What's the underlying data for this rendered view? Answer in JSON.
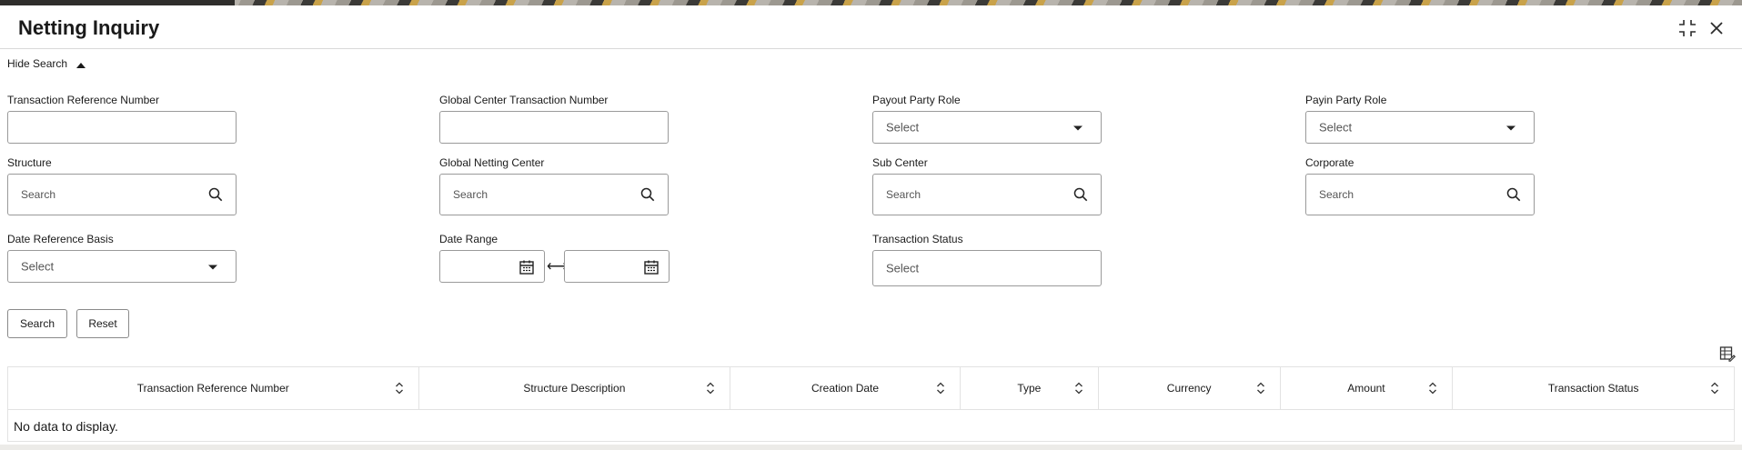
{
  "window": {
    "title": "Netting Inquiry"
  },
  "search_toggle": {
    "label": "Hide Search"
  },
  "fields": {
    "txn_ref": {
      "label": "Transaction Reference Number",
      "value": ""
    },
    "global_txn": {
      "label": "Global Center Transaction Number",
      "value": ""
    },
    "payout_role": {
      "label": "Payout Party Role",
      "placeholder": "Select"
    },
    "payin_role": {
      "label": "Payin Party Role",
      "placeholder": "Select"
    },
    "structure": {
      "label": "Structure",
      "placeholder": "Search"
    },
    "netting_center": {
      "label": "Global Netting Center",
      "placeholder": "Search"
    },
    "sub_center": {
      "label": "Sub Center",
      "placeholder": "Search"
    },
    "corporate": {
      "label": "Corporate",
      "placeholder": "Search"
    },
    "date_basis": {
      "label": "Date Reference Basis",
      "placeholder": "Select"
    },
    "date_range": {
      "label": "Date Range",
      "from": "",
      "to": ""
    },
    "txn_status": {
      "label": "Transaction Status",
      "placeholder": "Select"
    }
  },
  "buttons": {
    "search": "Search",
    "reset": "Reset"
  },
  "table": {
    "columns": [
      "Transaction Reference Number",
      "Structure Description",
      "Creation Date",
      "Type",
      "Currency",
      "Amount",
      "Transaction Status"
    ],
    "empty_message": "No data to display."
  },
  "colors": {
    "border": "#9a9a9a",
    "text": "#1a1a1a",
    "background": "#ffffff"
  }
}
